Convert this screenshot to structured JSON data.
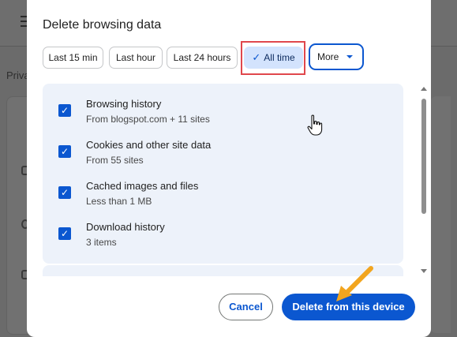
{
  "dialog": {
    "title": "Delete browsing data",
    "time_ranges": [
      {
        "label": "Last 15 min",
        "selected": false
      },
      {
        "label": "Last hour",
        "selected": false
      },
      {
        "label": "Last 24 hours",
        "selected": false
      },
      {
        "label": "All time",
        "selected": true
      }
    ],
    "more_label": "More",
    "items": [
      {
        "title": "Browsing history",
        "subtitle": "From blogspot.com + 11 sites",
        "checked": true
      },
      {
        "title": "Cookies and other site data",
        "subtitle": "From 55 sites",
        "checked": true
      },
      {
        "title": "Cached images and files",
        "subtitle": "Less than 1 MB",
        "checked": true
      },
      {
        "title": "Download history",
        "subtitle": "3 items",
        "checked": true
      }
    ],
    "cancel_label": "Cancel",
    "delete_label": "Delete from this device"
  },
  "background": {
    "partial_text": "Priva"
  },
  "colors": {
    "accent": "#0b57d0",
    "selected_chip": "#d3e3fd",
    "list_bg": "#edf2fa",
    "highlight_box": "#e0474c",
    "annotation_arrow": "#f2a51e"
  },
  "icons": {
    "check": "check-icon",
    "dropdown": "caret-down-icon",
    "cursor": "hand-cursor-icon",
    "arrow": "annotation-arrow-icon"
  }
}
